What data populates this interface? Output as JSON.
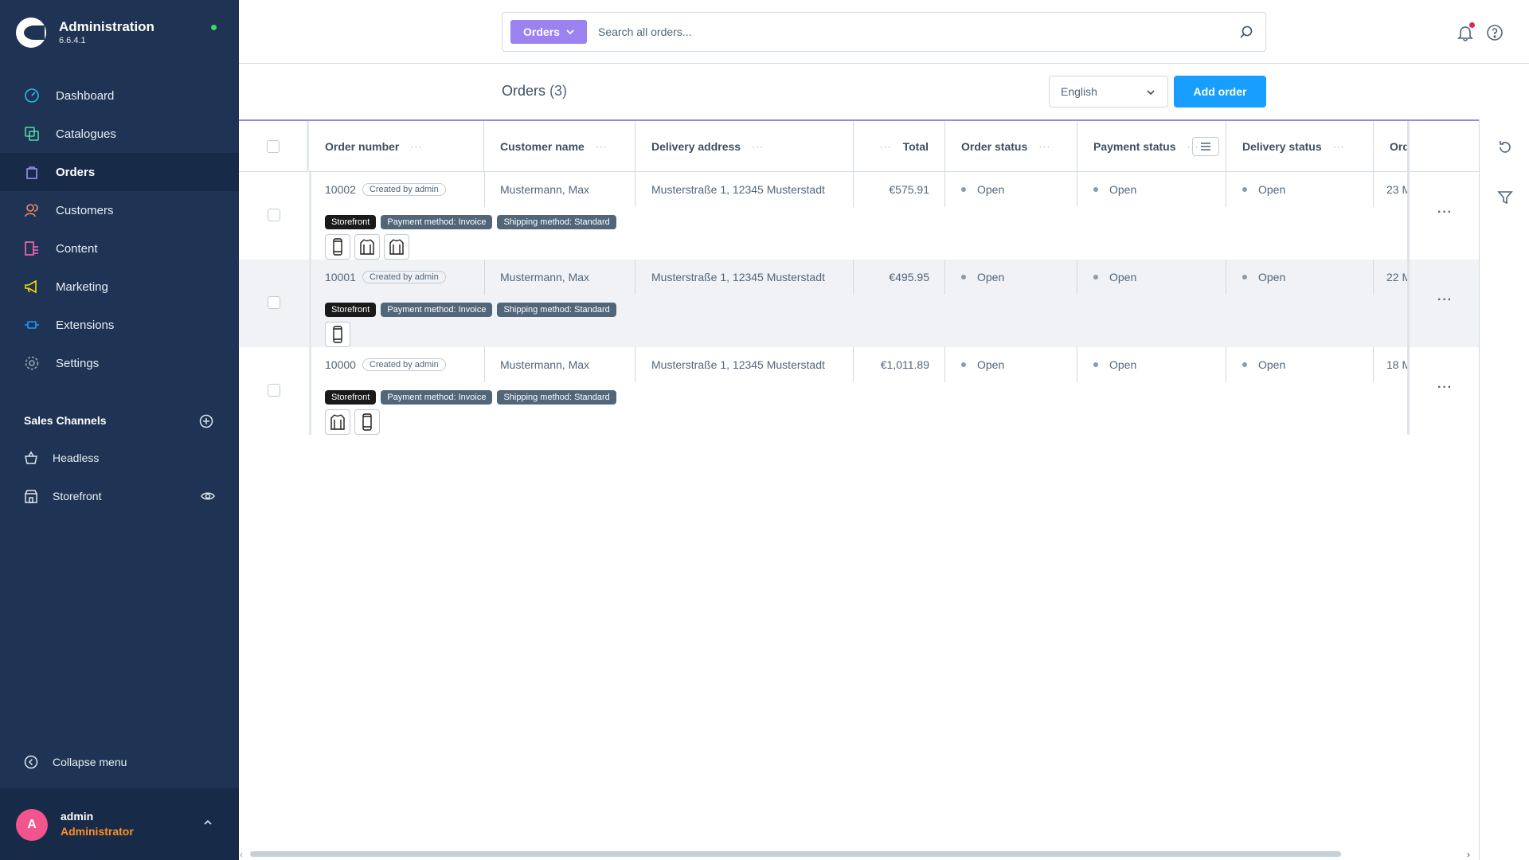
{
  "app": {
    "title": "Administration",
    "version": "6.6.4.1"
  },
  "nav": [
    {
      "label": "Dashboard",
      "icon": "dashboard-icon"
    },
    {
      "label": "Catalogues",
      "icon": "catalogues-icon"
    },
    {
      "label": "Orders",
      "icon": "orders-icon",
      "active": true
    },
    {
      "label": "Customers",
      "icon": "customers-icon"
    },
    {
      "label": "Content",
      "icon": "content-icon"
    },
    {
      "label": "Marketing",
      "icon": "marketing-icon"
    },
    {
      "label": "Extensions",
      "icon": "extensions-icon"
    },
    {
      "label": "Settings",
      "icon": "settings-icon"
    }
  ],
  "sales_channels": {
    "title": "Sales Channels",
    "items": [
      {
        "label": "Headless",
        "icon": "basket-icon"
      },
      {
        "label": "Storefront",
        "icon": "storefront-icon"
      }
    ]
  },
  "collapse_label": "Collapse menu",
  "user": {
    "initial": "A",
    "name": "admin",
    "role": "Administrator"
  },
  "search": {
    "type": "Orders",
    "placeholder": "Search all orders..."
  },
  "page": {
    "title": "Orders",
    "count": "(3)"
  },
  "language": "English",
  "add_order_label": "Add order",
  "columns": [
    "Order number",
    "Customer name",
    "Delivery address",
    "Total",
    "Order status",
    "Payment status",
    "Delivery status",
    "Order date"
  ],
  "rows": [
    {
      "number": "10002",
      "created": "Created by admin",
      "customer": "Mustermann, Max",
      "address": "Musterstraße 1, 12345 Musterstadt",
      "total": "€575.91",
      "order_status": "Open",
      "payment_status": "Open",
      "delivery_status": "Open",
      "date": "23 M",
      "tags": [
        "Storefront",
        "Payment method: Invoice",
        "Shipping method: Standard"
      ],
      "thumbs": [
        "phone-icon",
        "shirt-icon",
        "shirt-icon"
      ]
    },
    {
      "number": "10001",
      "created": "Created by admin",
      "customer": "Mustermann, Max",
      "address": "Musterstraße 1, 12345 Musterstadt",
      "total": "€495.95",
      "order_status": "Open",
      "payment_status": "Open",
      "delivery_status": "Open",
      "date": "22 M",
      "tags": [
        "Storefront",
        "Payment method: Invoice",
        "Shipping method: Standard"
      ],
      "thumbs": [
        "phone-icon"
      ]
    },
    {
      "number": "10000",
      "created": "Created by admin",
      "customer": "Mustermann, Max",
      "address": "Musterstraße 1, 12345 Musterstadt",
      "total": "€1,011.89",
      "order_status": "Open",
      "payment_status": "Open",
      "delivery_status": "Open",
      "date": "18 M",
      "tags": [
        "Storefront",
        "Payment method: Invoice",
        "Shipping method: Standard"
      ],
      "thumbs": [
        "shirt-icon",
        "phone-icon"
      ]
    }
  ],
  "colors": {
    "sidebar": "#1f3454",
    "accent": "#189eff",
    "search_badge": "#9b82f0",
    "avatar": "#f2548d",
    "role": "#ff8f25"
  }
}
